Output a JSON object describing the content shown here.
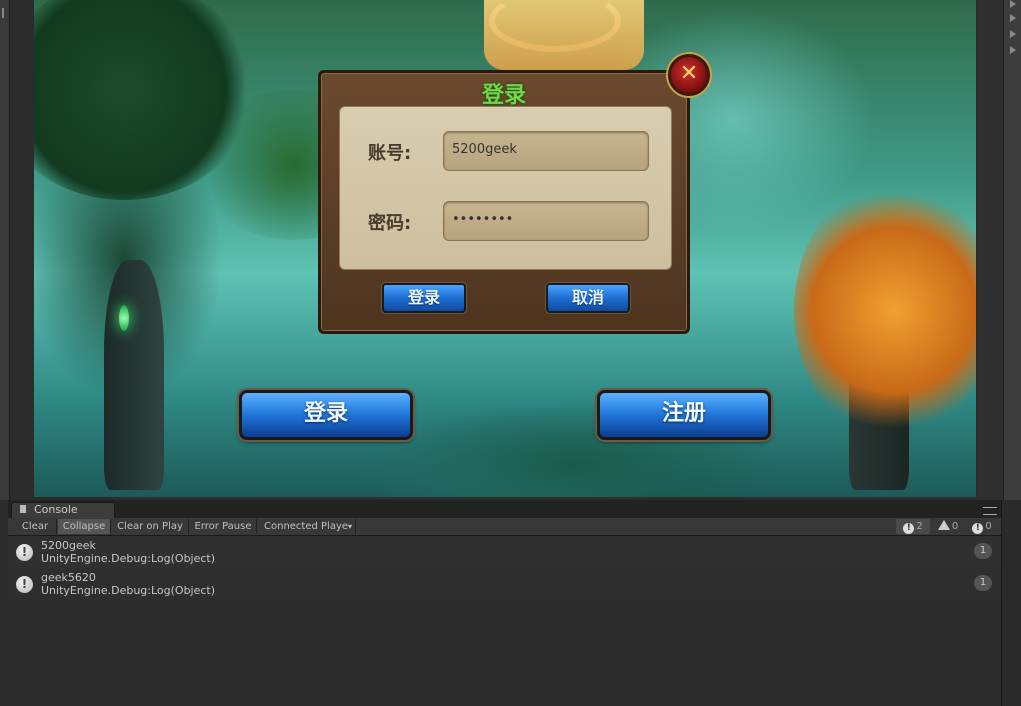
{
  "login_dialog": {
    "title": "登录",
    "account_label": "账号:",
    "account_value": "5200geek",
    "password_label": "密码:",
    "password_value": "••••••••",
    "login_button": "登录",
    "cancel_button": "取消",
    "close_icon": "close-x-icon"
  },
  "main_buttons": {
    "login": "登录",
    "register": "注册"
  },
  "console": {
    "tab_label": "Console",
    "toolbar": {
      "clear": "Clear",
      "collapse": "Collapse",
      "clear_on_play": "Clear on Play",
      "error_pause": "Error Pause",
      "connected_player": "Connected Playe"
    },
    "counters": {
      "log": "2",
      "warning": "0",
      "error": "0"
    },
    "entries": [
      {
        "message": "5200geek",
        "source": "UnityEngine.Debug:Log(Object)",
        "count": "1"
      },
      {
        "message": "geek5620",
        "source": "UnityEngine.Debug:Log(Object)",
        "count": "1"
      }
    ]
  }
}
